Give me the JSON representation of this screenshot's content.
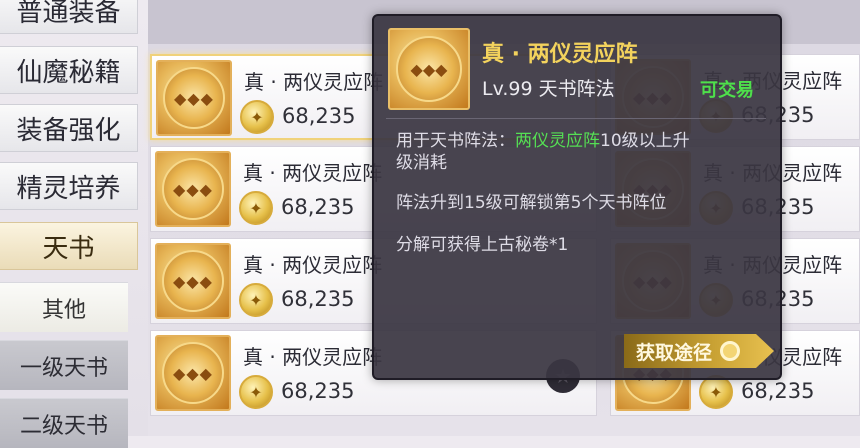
{
  "sidebar": {
    "tabs": [
      {
        "label": "普通装备"
      },
      {
        "label": "仙魔秘籍"
      },
      {
        "label": "装备强化"
      },
      {
        "label": "精灵培养"
      },
      {
        "label": "天书"
      }
    ],
    "subs": [
      {
        "label": "其他"
      },
      {
        "label": "一级天书"
      },
      {
        "label": "二级天书"
      }
    ]
  },
  "items": [
    {
      "name": "真 · 两仪灵应阵",
      "price": "68,235"
    },
    {
      "name": "真 · 两仪灵应阵",
      "price": "68,235"
    },
    {
      "name": "真 · 两仪灵应阵",
      "price": "68,235"
    },
    {
      "name": "真 · 两仪灵应阵",
      "price": "68,235"
    },
    {
      "name": "真 · 两仪灵应阵",
      "price": "68,235"
    },
    {
      "name": "真 · 两仪灵应阵",
      "price": "68,235"
    },
    {
      "name": "真 · 两仪灵应阵",
      "price": "68,235"
    },
    {
      "name": "真 · 两仪灵应阵",
      "price": "68,235"
    }
  ],
  "tooltip": {
    "title": "真 · 两仪灵应阵",
    "level": "Lv.99  天书阵法",
    "tradeable": "可交易",
    "desc1_prefix": "用于天书阵法：",
    "desc1_highlight": "两仪灵应阵",
    "desc1_suffix": "10级以上升",
    "desc1_cont": "级消耗",
    "desc2": "阵法升到15级可解锁第5个天书阵位",
    "desc3": "分解可获得上古秘卷*1",
    "get_path": "获取途径"
  },
  "icons": {
    "coin": "coin-icon",
    "star": "star-icon",
    "item": "talisman-disc-icon"
  }
}
